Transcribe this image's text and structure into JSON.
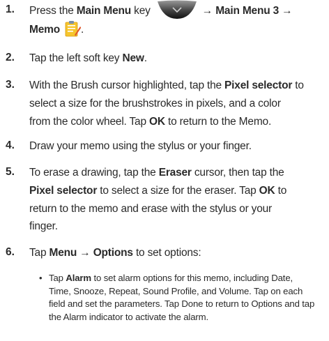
{
  "steps": [
    {
      "number": "1.",
      "press": "Press the ",
      "main_menu_key": "Main Menu",
      "key_word": " key ",
      "arrow_path": "→ Main Menu 3 →",
      "memo": "Memo",
      "period": "."
    },
    {
      "number": "2.",
      "pre": "Tap the left soft key ",
      "new": "New",
      "post": "."
    },
    {
      "number": "3.",
      "line1_pre": "With the Brush cursor highlighted, tap the ",
      "pixel_selector": "Pixel selector",
      "line1_post": " to",
      "line2": "select a size for the brushstrokes in pixels, and a color",
      "line3_pre": "from the color wheel. Tap ",
      "ok": "OK",
      "line3_post": " to return to the Memo."
    },
    {
      "number": "4.",
      "text": "Draw your memo using the stylus or your finger."
    },
    {
      "number": "5.",
      "line1_pre": "To erase a drawing, tap the ",
      "eraser": "Eraser",
      "line1_post": " cursor, then tap the",
      "pixel_selector": "Pixel selector",
      "line2_mid": " to select a size for the eraser.  Tap ",
      "ok": "OK",
      "line2_post": " to",
      "line3": "return to the memo and erase with the stylus or your",
      "line4": "finger."
    },
    {
      "number": "6.",
      "pre": "Tap ",
      "menu": "Menu",
      "arrow": " → ",
      "options": "Options",
      "post": " to set options:"
    }
  ],
  "alarm_bullet": {
    "bullet": "•",
    "tap": "Tap ",
    "alarm": "Alarm",
    "line1_post": " to set alarm options for this memo, including Date,",
    "line2": "Time, Snooze, Repeat, Sound Profile, and Volume.  Tap on each",
    "line3": "field and set the parameters. Tap Done to return to Options and tap",
    "line4": "the Alarm indicator to activate the alarm."
  },
  "icons": {
    "main_menu_key": "main-menu-key-icon",
    "memo": "memo-app-icon"
  }
}
